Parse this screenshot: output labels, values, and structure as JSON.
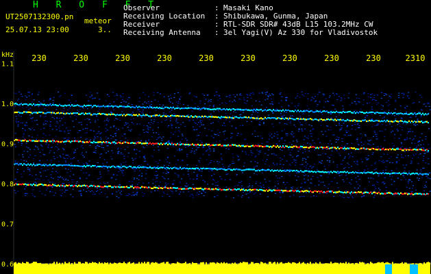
{
  "header": {
    "title": "H R O F F T",
    "filename": "UT2507132300.pn",
    "mode": "meteor",
    "date_time": "25.07.13 23:00",
    "sub": "3..",
    "fields": [
      {
        "label": "Observer",
        "value": "Masaki Kano"
      },
      {
        "label": "Receiving Location",
        "value": "Shibukawa, Gunma, Japan"
      },
      {
        "label": "Receiver",
        "value": "RTL-SDR SDR# 43dB L15 103.2MHz CW"
      },
      {
        "label": "Receiving Antenna",
        "value": "3el Yagi(V) Az 330 for Vladivostok"
      }
    ]
  },
  "axes": {
    "y_unit": "kHz",
    "y_ticks": [
      "1.1",
      "1.0",
      "0.9",
      "0.8",
      "0.7",
      "0.6"
    ],
    "y_values": [
      1.1,
      1.0,
      0.9,
      0.8,
      0.7,
      0.6
    ],
    "x_ticks": [
      "230",
      "230",
      "230",
      "230",
      "230",
      "230",
      "230",
      "230",
      "230",
      "2310"
    ],
    "x_ticks_hint": "partially truncated labels as displayed",
    "ylim": [
      0.6,
      1.13
    ]
  },
  "colors": {
    "background": "#000000",
    "label_yellow": "#ffff00",
    "text_white": "#ffffff",
    "title_green": "#00ff00",
    "noise_blue": "#0026cc",
    "signal_cyan": "#00ffff",
    "signal_red": "#ff2020",
    "bottom_bar": "#ffff00"
  },
  "traces": [
    {
      "freq": 1.0,
      "intensity": "medium"
    },
    {
      "freq": 0.98,
      "intensity": "high"
    },
    {
      "freq": 0.91,
      "intensity": "strong"
    },
    {
      "freq": 0.85,
      "intensity": "medium"
    },
    {
      "freq": 0.8,
      "intensity": "strong"
    }
  ]
}
